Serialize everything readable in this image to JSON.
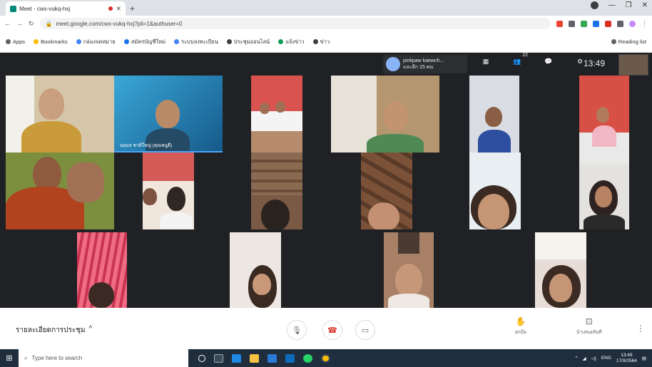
{
  "browser": {
    "tab_title": "Meet - cwx-vukq-hxj",
    "new_tab": "+",
    "address": "meet.google.com/cwx-vukq-hxj?pli=1&authuser=0",
    "bookmarks": [
      "Apps",
      "Bookmarks",
      "กล่องจดหมาย",
      "สมัครบัญชีใหม่",
      "ระบบลงทะเบียน",
      "ประชุมออนไลน์",
      "แจ้งข่าว",
      "ข่าว",
      "Reading list"
    ]
  },
  "meet": {
    "presenter": {
      "line1": "pinkpaw kaewch...",
      "line2": "และอีก 15 คน"
    },
    "participant_count": "22",
    "clock": "13:49",
    "name_label": "นฤมล ชาติใหญ่ (คุณหนูดี)"
  },
  "controls": {
    "meeting_name": "รายละเอียดการประชุม",
    "chevron": "^",
    "mic": "🎙",
    "end": "☎",
    "cam": "▭",
    "raise_hand": "ยกมือ",
    "present": "นำเสนอทันที",
    "more": "⋮"
  },
  "taskbar": {
    "search_placeholder": "Type here to search",
    "time": "13:49",
    "date": "17/9/2564",
    "lang": "ENG"
  },
  "colors": {
    "meet_bg": "#202124",
    "end_red": "#d93025",
    "taskbar": "#1f2d3d"
  }
}
